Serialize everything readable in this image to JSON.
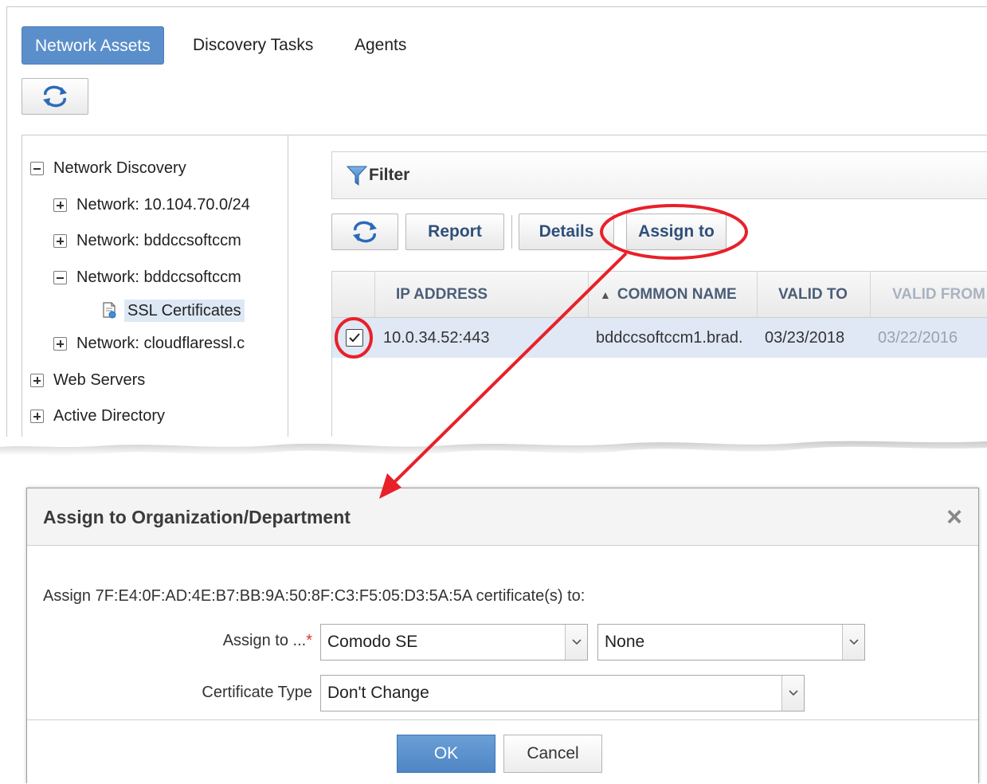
{
  "tabs": [
    {
      "label": "Network Assets",
      "active": true
    },
    {
      "label": "Discovery Tasks",
      "active": false
    },
    {
      "label": "Agents",
      "active": false
    }
  ],
  "tree": {
    "items": [
      {
        "label": "Network Discovery",
        "state": "expanded"
      },
      {
        "label": "Network: 10.104.70.0/24",
        "state": "collapsed"
      },
      {
        "label": "Network: bddccsoftccm",
        "state": "collapsed"
      },
      {
        "label": "Network: bddccsoftccm",
        "state": "expanded"
      },
      {
        "label": "SSL Certificates",
        "state": "leaf",
        "selected": true
      },
      {
        "label": "Network: cloudflaressl.c",
        "state": "collapsed"
      },
      {
        "label": "Web Servers",
        "state": "collapsed"
      },
      {
        "label": "Active Directory",
        "state": "collapsed"
      }
    ]
  },
  "filter": {
    "label": "Filter"
  },
  "toolbar": {
    "report_label": "Report",
    "details_label": "Details",
    "assign_label": "Assign to"
  },
  "grid": {
    "columns": [
      {
        "label": "IP ADDRESS"
      },
      {
        "label": "COMMON NAME",
        "sort": "ascending",
        "sort_glyph": "▲"
      },
      {
        "label": "VALID TO"
      },
      {
        "label": "VALID FROM"
      }
    ],
    "rows": [
      {
        "checked": true,
        "ip": "10.0.34.52:443",
        "common_name": "bddccsoftccm1.brad.",
        "valid_to": "03/23/2018",
        "valid_from": "03/22/2016"
      }
    ]
  },
  "dialog": {
    "title": "Assign to Organization/Department",
    "close_glyph": "×",
    "message": "Assign 7F:E4:0F:AD:4E:B7:BB:9A:50:8F:C3:F5:05:D3:5A:5A certificate(s) to:",
    "assign_label": "Assign to ...",
    "required_mark": "*",
    "org_value": "Comodo SE",
    "dept_value": "None",
    "cert_type_label": "Certificate Type",
    "cert_type_value": "Don't Change",
    "ok_label": "OK",
    "cancel_label": "Cancel"
  },
  "colors": {
    "accent": "#5b8fcb",
    "annotation": "#e8202a",
    "row_selected": "#dfe8f4"
  }
}
